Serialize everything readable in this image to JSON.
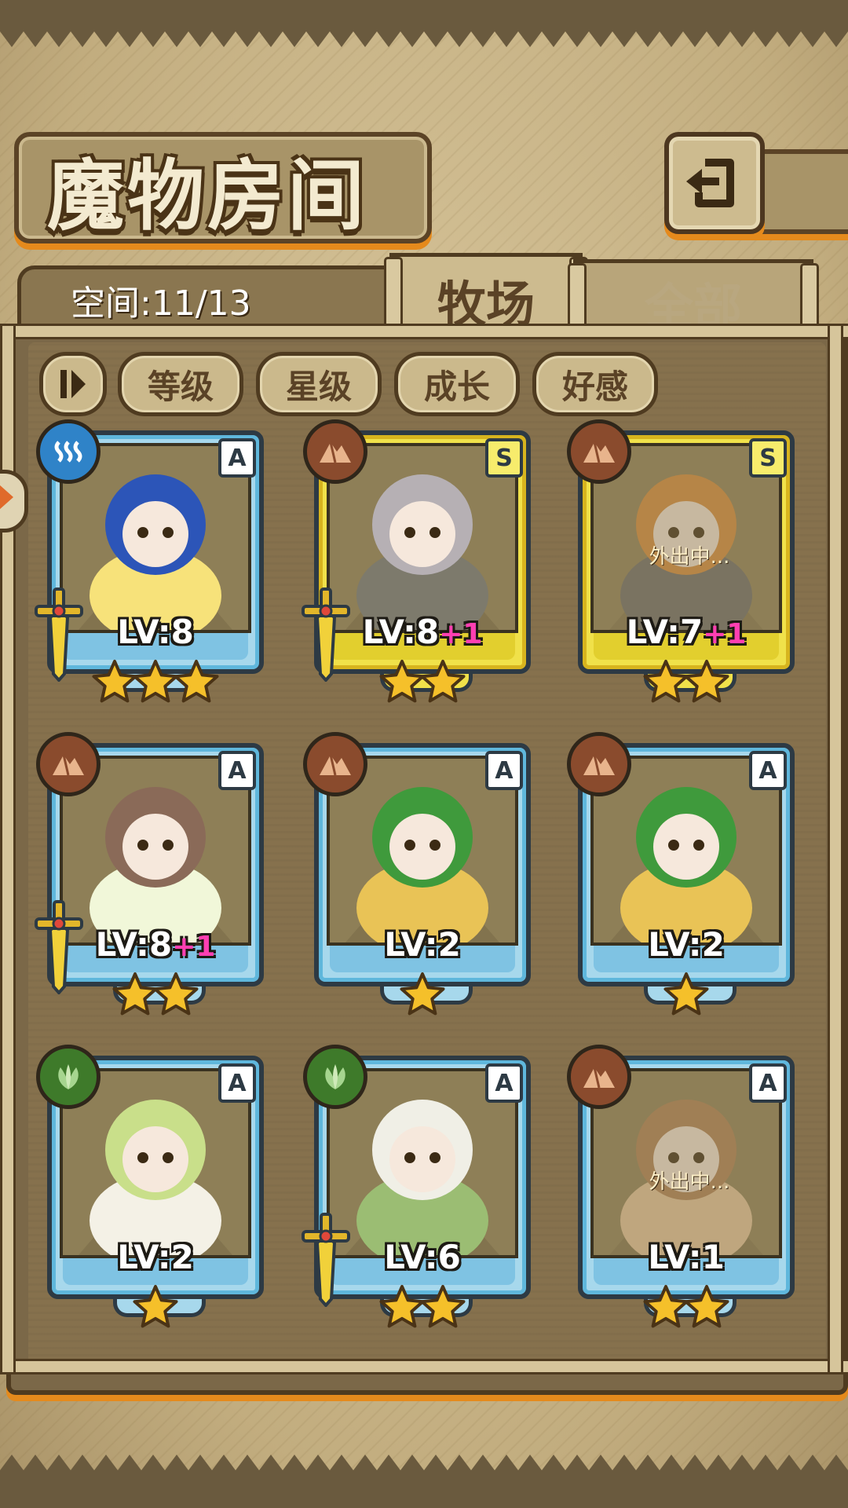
{
  "header": {
    "title": "魔物房间",
    "back_icon": "back-arrow-icon"
  },
  "tabs": {
    "space_label": "空间:11/13",
    "ranch": "牧场",
    "all": "全部"
  },
  "sort_buttons": [
    "等级",
    "星级",
    "成长",
    "好感"
  ],
  "away_text": "外出中...",
  "colors": {
    "accent_orange": "#e58a1c",
    "rank_a": "#a7d8ec",
    "rank_s": "#f0e14a",
    "plus_level": "#ff3fb2"
  },
  "monsters": [
    {
      "rank": "A",
      "element": "water",
      "level": "LV:8",
      "plus": "",
      "stars": 3,
      "equipped": true,
      "away": false
    },
    {
      "rank": "S",
      "element": "earth",
      "level": "LV:8",
      "plus": "+1",
      "stars": 2,
      "equipped": true,
      "away": false
    },
    {
      "rank": "S",
      "element": "earth",
      "level": "LV:7",
      "plus": "+1",
      "stars": 2,
      "equipped": false,
      "away": true
    },
    {
      "rank": "A",
      "element": "earth",
      "level": "LV:8",
      "plus": "+1",
      "stars": 2,
      "equipped": true,
      "away": false
    },
    {
      "rank": "A",
      "element": "earth",
      "level": "LV:2",
      "plus": "",
      "stars": 1,
      "equipped": false,
      "away": false
    },
    {
      "rank": "A",
      "element": "earth",
      "level": "LV:2",
      "plus": "",
      "stars": 1,
      "equipped": false,
      "away": false
    },
    {
      "rank": "A",
      "element": "plant",
      "level": "LV:2",
      "plus": "",
      "stars": 1,
      "equipped": false,
      "away": false
    },
    {
      "rank": "A",
      "element": "plant",
      "level": "LV:6",
      "plus": "",
      "stars": 2,
      "equipped": true,
      "away": false
    },
    {
      "rank": "A",
      "element": "earth",
      "level": "LV:1",
      "plus": "",
      "stars": 2,
      "equipped": false,
      "away": true
    }
  ]
}
